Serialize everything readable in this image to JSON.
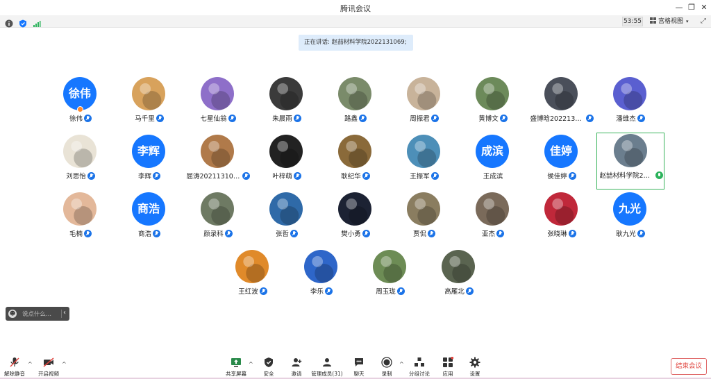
{
  "window": {
    "title": "腾讯会议"
  },
  "toolbar": {
    "timer": "53:55",
    "view_label": "宫格视图"
  },
  "speaking": {
    "text": "正在讲话: 赵喆材料学院2022131069;"
  },
  "participants": [
    {
      "name": "徐伟",
      "avatar_text": "徐伟",
      "avatar_color": "#1677ff",
      "mic": "muted",
      "host": true
    },
    {
      "name": "马千里",
      "avatar_color": "#d8a25c",
      "mic": "muted"
    },
    {
      "name": "七星仙翁",
      "avatar_color": "#8e6fc9",
      "mic": "muted"
    },
    {
      "name": "朱晨雨",
      "avatar_color": "#3b3b3b",
      "mic": "muted"
    },
    {
      "name": "路鑫",
      "avatar_color": "#7a8b6a",
      "mic": "muted"
    },
    {
      "name": "周振君",
      "avatar_color": "#c8b39a",
      "mic": "muted"
    },
    {
      "name": "黄博文",
      "avatar_color": "#6c8a5a",
      "mic": "muted"
    },
    {
      "name": "盛博晗2022131...",
      "avatar_color": "#4a4f5a",
      "mic": "muted"
    },
    {
      "name": "潘维杰",
      "avatar_color": "#5a5fd0",
      "mic": "muted"
    },
    {
      "name": "刘思怡",
      "avatar_color": "#e9e3d6",
      "mic": "muted"
    },
    {
      "name": "李辉",
      "avatar_text": "李辉",
      "avatar_color": "#1677ff",
      "mic": "muted"
    },
    {
      "name": "屈涛2021131053",
      "avatar_color": "#b07a4a",
      "mic": "muted"
    },
    {
      "name": "叶梓萌",
      "avatar_color": "#222222",
      "mic": "muted"
    },
    {
      "name": "耿纪华",
      "avatar_color": "#8a6a3a",
      "mic": "muted"
    },
    {
      "name": "王振军",
      "avatar_color": "#4d8fb8",
      "mic": "muted"
    },
    {
      "name": "王成滨",
      "avatar_text": "成滨",
      "avatar_color": "#1677ff",
      "mic": "none"
    },
    {
      "name": "侯佳婷",
      "avatar_text": "佳婷",
      "avatar_color": "#1677ff",
      "mic": "muted"
    },
    {
      "name": "赵喆材料学院20...",
      "avatar_color": "#6b7e8e",
      "mic": "on",
      "active": true
    },
    {
      "name": "毛楠",
      "avatar_color": "#e3b89a",
      "mic": "muted"
    },
    {
      "name": "商浩",
      "avatar_text": "商浩",
      "avatar_color": "#1677ff",
      "mic": "muted"
    },
    {
      "name": "颜录科",
      "avatar_color": "#6e7a63",
      "mic": "muted"
    },
    {
      "name": "张哲",
      "avatar_color": "#2f6aa8",
      "mic": "muted"
    },
    {
      "name": "樊小勇",
      "avatar_color": "#1c2233",
      "mic": "muted"
    },
    {
      "name": "贾侃",
      "avatar_color": "#8a7d60",
      "mic": "muted"
    },
    {
      "name": "亚杰",
      "avatar_color": "#7a6a5a",
      "mic": "muted"
    },
    {
      "name": "张晓琳",
      "avatar_color": "#c0283a",
      "mic": "muted"
    },
    {
      "name": "耿九光",
      "avatar_text": "九光",
      "avatar_color": "#1677ff",
      "mic": "muted"
    },
    {
      "name": "王红波",
      "avatar_color": "#e08a2a",
      "mic": "muted"
    },
    {
      "name": "李乐",
      "avatar_color": "#2e66c9",
      "mic": "muted"
    },
    {
      "name": "周玉珑",
      "avatar_color": "#6d8c55",
      "mic": "muted"
    },
    {
      "name": "高雁北",
      "avatar_color": "#5a6450",
      "mic": "muted"
    }
  ],
  "chat": {
    "placeholder": "说点什么..."
  },
  "controls": {
    "unmute": "解除静音",
    "start_video": "开启视频",
    "share": "共享屏幕",
    "security": "安全",
    "invite": "邀请",
    "members": "管理成员(31)",
    "chat": "聊天",
    "record": "录制",
    "breakout": "分组讨论",
    "apps": "应用",
    "settings": "设置",
    "end": "结束会议"
  },
  "colors": {
    "accent": "#1677ff",
    "end_red": "#e0453f",
    "active_green": "#38b35a"
  }
}
